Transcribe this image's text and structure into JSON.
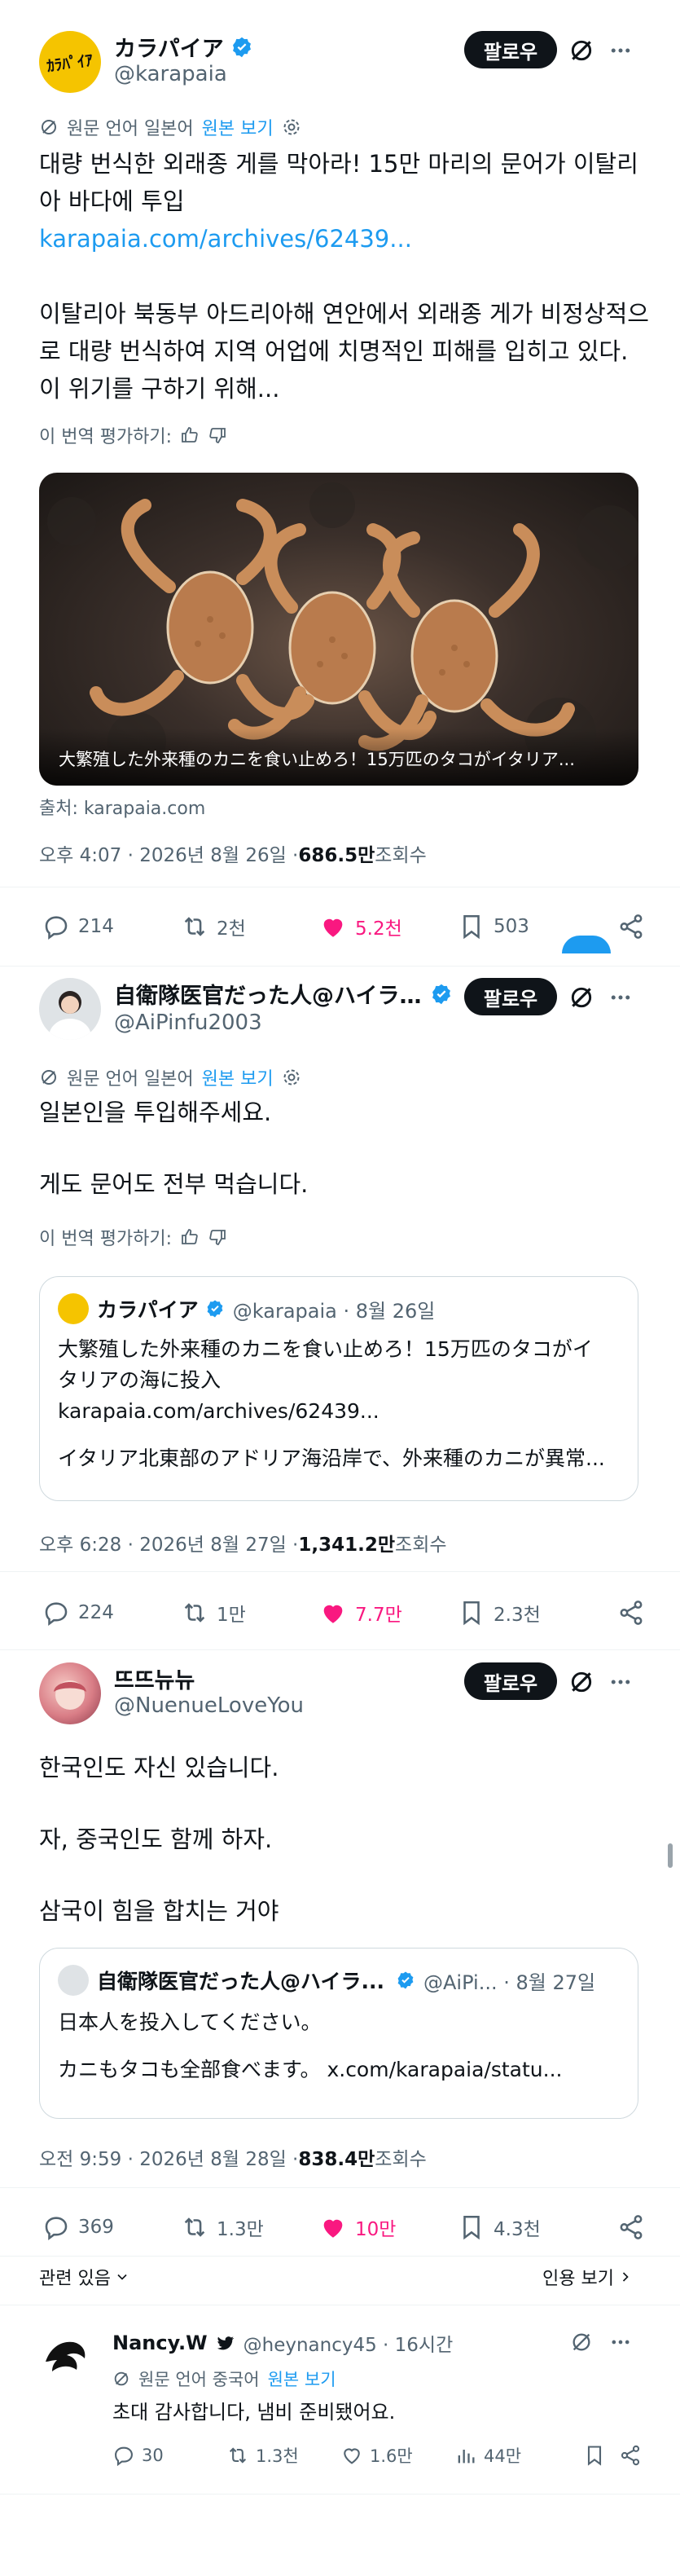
{
  "colors": {
    "accent": "#1d9bf0",
    "like": "#f91880",
    "text": "#0f1419",
    "muted": "#536471",
    "follow_bg": "#0f1419"
  },
  "post1": {
    "name": "カラパイア",
    "handle": "@karapaia",
    "follow_label": "팔로우",
    "translate_note": "원문 언어 일본어",
    "show_original": "원본 보기",
    "text_line1": "대량 번식한 외래종 게를 막아라! 15만 마리의 문어가 이탈리",
    "text_line2": "아 바다에 투입",
    "link": "karapaia.com/archives/62439...",
    "text_line3": "이탈리아 북동부 아드리아해 연안에서 외래종 게가 비정상적으",
    "text_line4": "로 대량 번식하여 지역 어업에 치명적인 피해를 입히고 있다.",
    "text_line5": "이 위기를 구하기 위해...",
    "rate_translation": "이 번역 평가하기:",
    "image_caption": "大繁殖した外来種のカニを食い止めろ！15万匹のタコがイタリア...",
    "source": "출처: karapaia.com",
    "timestamp": "오후 4:07 · 2026년 8월 26일 · ",
    "views_value": "686.5만",
    "views_label": " 조회수",
    "replies": "214",
    "reposts": "2천",
    "likes": "5.2천",
    "bookmarks": "503"
  },
  "post2": {
    "name": "自衛隊医官だった人@ハイライ...",
    "handle": "@AiPinfu2003",
    "follow_label": "팔로우",
    "translate_note": "원문 언어 일본어",
    "show_original": "원본 보기",
    "text_line1": "일본인을 투입해주세요.",
    "text_line2": "게도 문어도 전부 먹습니다.",
    "rate_translation": "이 번역 평가하기:",
    "quote_name": "カラパイア",
    "quote_handle": "@karapaia · 8월 26일",
    "quote_line1": "大繁殖した外来種のカニを食い止めろ！15万匹のタコがイ",
    "quote_line2": "タリアの海に投入",
    "quote_line3": "karapaia.com/archives/62439...",
    "quote_line4": "イタリア北東部のアドリア海沿岸で、外来種のカニが異常...",
    "timestamp": "오후 6:28 · 2026년 8월 27일 · ",
    "views_value": "1,341.2만",
    "views_label": " 조회수",
    "replies": "224",
    "reposts": "1만",
    "likes": "7.7만",
    "bookmarks": "2.3천"
  },
  "post3": {
    "name": "뜨뜨뉴뉴",
    "handle": "@NuenueLoveYou",
    "follow_label": "팔로우",
    "text_line1": "한국인도 자신 있습니다.",
    "text_line2": "자, 중국인도 함께 하자.",
    "text_line3": "삼국이 힘을 합치는 거야",
    "quote_name": "自衛隊医官だった人@ハイラ...",
    "quote_handle": "@AiPi... · 8월 27일",
    "quote_line1": "日本人を投入してください。",
    "quote_line2": "カニもタコも全部食べます。 x.com/karapaia/statu...",
    "timestamp": "오전 9:59 · 2026년 8월 28일 · ",
    "views_value": "838.4만",
    "views_label": " 조회수",
    "replies": "369",
    "reposts": "1.3만",
    "likes": "10만",
    "bookmarks": "4.3천",
    "relevant": "관련 있음",
    "quotes_link": "인용 보기"
  },
  "reply": {
    "name": "Nancy.W",
    "handle": "@heynancy45 · 16시간",
    "translate_note": "원문 언어 중국어",
    "show_original": "원본 보기",
    "text": "초대 감사합니다, 냄비 준비됐어요.",
    "replies": "30",
    "reposts": "1.3천",
    "likes": "1.6만",
    "views": "44만"
  }
}
